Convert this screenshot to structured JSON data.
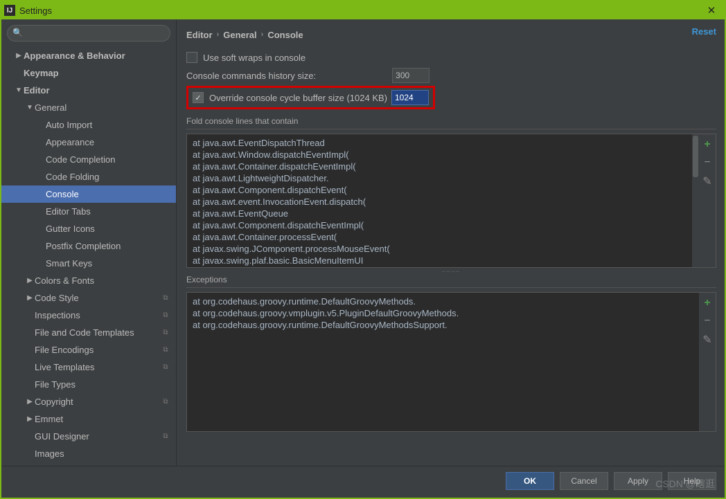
{
  "window": {
    "title": "Settings"
  },
  "sidebar": {
    "search_placeholder": "",
    "items": [
      {
        "label": "Appearance & Behavior",
        "indent": 0,
        "arrow": "▶",
        "bold": true
      },
      {
        "label": "Keymap",
        "indent": 0,
        "arrow": "",
        "bold": true
      },
      {
        "label": "Editor",
        "indent": 0,
        "arrow": "▼",
        "bold": true
      },
      {
        "label": "General",
        "indent": 1,
        "arrow": "▼",
        "bold": false
      },
      {
        "label": "Auto Import",
        "indent": 2,
        "arrow": "",
        "bold": false
      },
      {
        "label": "Appearance",
        "indent": 2,
        "arrow": "",
        "bold": false
      },
      {
        "label": "Code Completion",
        "indent": 2,
        "arrow": "",
        "bold": false
      },
      {
        "label": "Code Folding",
        "indent": 2,
        "arrow": "",
        "bold": false
      },
      {
        "label": "Console",
        "indent": 2,
        "arrow": "",
        "bold": false,
        "selected": true
      },
      {
        "label": "Editor Tabs",
        "indent": 2,
        "arrow": "",
        "bold": false
      },
      {
        "label": "Gutter Icons",
        "indent": 2,
        "arrow": "",
        "bold": false
      },
      {
        "label": "Postfix Completion",
        "indent": 2,
        "arrow": "",
        "bold": false
      },
      {
        "label": "Smart Keys",
        "indent": 2,
        "arrow": "",
        "bold": false
      },
      {
        "label": "Colors & Fonts",
        "indent": 1,
        "arrow": "▶",
        "bold": false
      },
      {
        "label": "Code Style",
        "indent": 1,
        "arrow": "▶",
        "bold": false,
        "badge": true
      },
      {
        "label": "Inspections",
        "indent": 1,
        "arrow": "",
        "bold": false,
        "badge": true
      },
      {
        "label": "File and Code Templates",
        "indent": 1,
        "arrow": "",
        "bold": false,
        "badge": true
      },
      {
        "label": "File Encodings",
        "indent": 1,
        "arrow": "",
        "bold": false,
        "badge": true
      },
      {
        "label": "Live Templates",
        "indent": 1,
        "arrow": "",
        "bold": false,
        "badge": true
      },
      {
        "label": "File Types",
        "indent": 1,
        "arrow": "",
        "bold": false
      },
      {
        "label": "Copyright",
        "indent": 1,
        "arrow": "▶",
        "bold": false,
        "badge": true
      },
      {
        "label": "Emmet",
        "indent": 1,
        "arrow": "▶",
        "bold": false
      },
      {
        "label": "GUI Designer",
        "indent": 1,
        "arrow": "",
        "bold": false,
        "badge": true
      },
      {
        "label": "Images",
        "indent": 1,
        "arrow": "",
        "bold": false
      }
    ]
  },
  "breadcrumb": [
    "Editor",
    "General",
    "Console"
  ],
  "reset_label": "Reset",
  "options": {
    "soft_wrap": {
      "label": "Use soft wraps in console",
      "checked": false
    },
    "history_size": {
      "label": "Console commands history size:",
      "value": "300"
    },
    "override_buffer": {
      "label": "Override console cycle buffer size (1024 KB)",
      "checked": true,
      "value": "1024"
    }
  },
  "fold_section": {
    "label": "Fold console lines that contain"
  },
  "fold_lines": "at java.awt.EventDispatchThread\nat java.awt.Window.dispatchEventImpl(\nat java.awt.Container.dispatchEventImpl(\nat java.awt.LightweightDispatcher.\nat java.awt.Component.dispatchEvent(\nat java.awt.event.InvocationEvent.dispatch(\nat java.awt.EventQueue\nat java.awt.Component.dispatchEventImpl(\nat java.awt.Container.processEvent(\nat javax.swing.JComponent.processMouseEvent(\nat javax.swing.plaf.basic.BasicMenuItemUI",
  "exceptions_section": {
    "label": "Exceptions"
  },
  "exceptions_lines": "at org.codehaus.groovy.runtime.DefaultGroovyMethods.\nat org.codehaus.groovy.vmplugin.v5.PluginDefaultGroovyMethods.\nat org.codehaus.groovy.runtime.DefaultGroovyMethodsSupport.",
  "buttons": {
    "ok": "OK",
    "cancel": "Cancel",
    "apply": "Apply",
    "help": "Help"
  },
  "watermark": "CSDN @瞎逛"
}
